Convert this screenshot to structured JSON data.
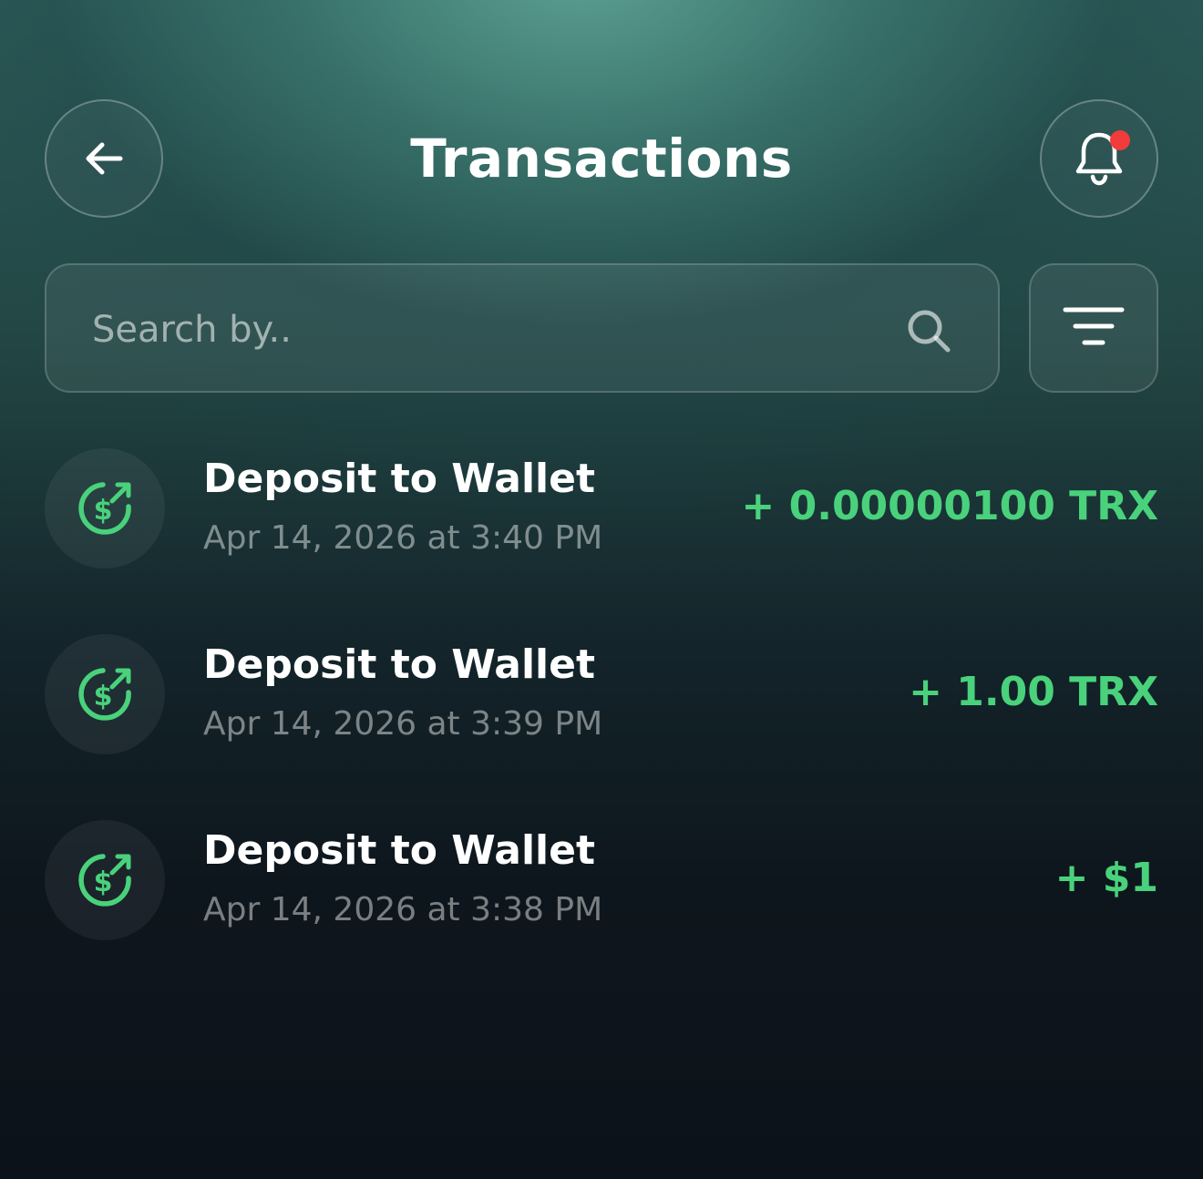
{
  "header": {
    "title": "Transactions",
    "back_icon": "arrow-left-icon",
    "notification_icon": "bell-icon",
    "notification_badge_color": "#f23b3b"
  },
  "search": {
    "placeholder": "Search by..",
    "value": "",
    "icon": "search-icon"
  },
  "filter": {
    "icon": "filter-icon"
  },
  "colors": {
    "amount_positive": "#49d27b",
    "icon_accent": "#49d27b"
  },
  "transactions": [
    {
      "title": "Deposit to Wallet",
      "date": "Apr 14, 2026 at 3:40 PM",
      "amount": "+ 0.00000100 TRX",
      "icon": "deposit-dollar-icon"
    },
    {
      "title": "Deposit to Wallet",
      "date": "Apr 14, 2026 at 3:39 PM",
      "amount": "+ 1.00 TRX",
      "icon": "deposit-dollar-icon"
    },
    {
      "title": "Deposit to Wallet",
      "date": "Apr 14, 2026 at 3:38 PM",
      "amount": "+ $1",
      "icon": "deposit-dollar-icon"
    }
  ]
}
